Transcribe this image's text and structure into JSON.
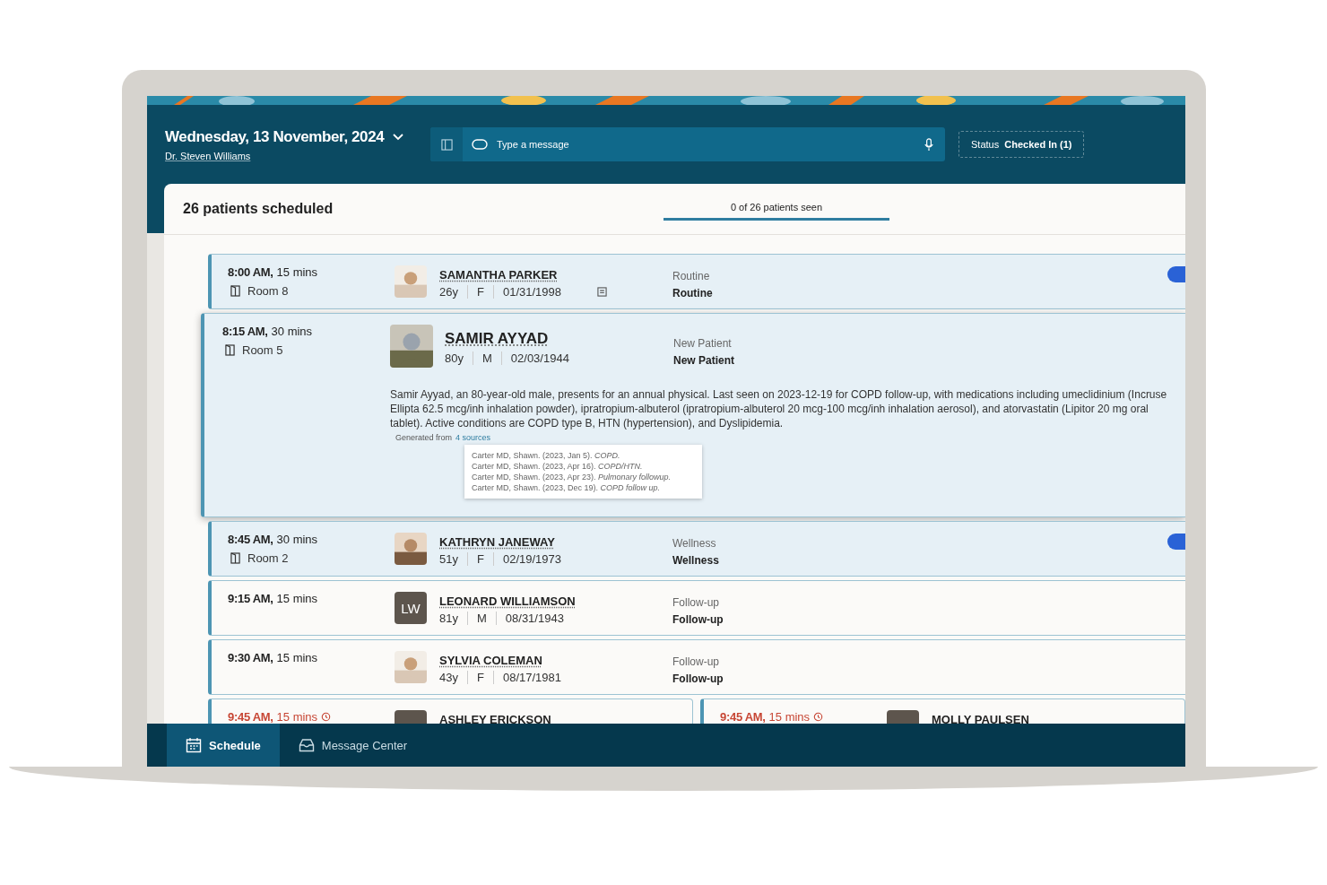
{
  "header": {
    "date": "Wednesday, 13 November, 2024",
    "doctor": "Dr. Steven Williams",
    "message_field": {
      "placeholder": "Type a message"
    },
    "status_button": {
      "label": "Status",
      "value": "Checked In (1)"
    }
  },
  "schedule": {
    "title": "26 patients scheduled",
    "progress": {
      "label": "0 of 26 patients seen",
      "level": 0
    },
    "slots": [
      {
        "appointments": [
          {
            "time": "8:00 AM,",
            "duration": "15 mins",
            "room": "Room 8",
            "name": "SAMANTHA PARKER",
            "age": "26y",
            "sex": "F",
            "dob": "01/31/1998",
            "has_note": true,
            "visit_type": "Routine",
            "reason": "Routine",
            "checked_in": true,
            "late": false,
            "expanded": false,
            "visibility_toggle": true
          }
        ]
      },
      {
        "appointments": [
          {
            "time": "8:15 AM,",
            "duration": "30 mins",
            "room": "Room 5",
            "name": "SAMIR AYYAD",
            "age": "80y",
            "sex": "M",
            "dob": "02/03/1944",
            "has_note": false,
            "visit_type": "New Patient",
            "reason": "New Patient",
            "checked_in": true,
            "late": false,
            "expanded": true,
            "visibility_toggle": false,
            "summary": "Samir Ayyad, an 80-year-old male, presents for an annual physical. Last seen on 2023-12-19 for COPD follow-up, with medications including umeclidinium (Incruse Ellipta 62.5 mcg/inh inhalation powder), ipratropium-albuterol (ipratropium-albuterol 20 mcg-100 mcg/inh inhalation aerosol), and atorvastatin (Lipitor 20 mg oral tablet). Active conditions are COPD type B, HTN (hypertension), and Dyslipidemia.",
            "sources_label": "Generated from",
            "sources_link": "4 sources",
            "sources": [
              "Carter MD, Shawn. (2023, Jan 5). *COPD.*",
              "Carter MD, Shawn. (2023, Apr 16). *COPD/HTN.*",
              "Carter MD, Shawn. (2023, Apr 23). *Pulmonary followup.*",
              "Carter MD, Shawn. (2023, Dec 19). *COPD follow up.*"
            ]
          }
        ]
      },
      {
        "appointments": [
          {
            "time": "8:45 AM,",
            "duration": "30 mins",
            "room": "Room 2",
            "name": "KATHRYN JANEWAY",
            "age": "51y",
            "sex": "F",
            "dob": "02/19/1973",
            "has_note": false,
            "visit_type": "Wellness",
            "reason": "Wellness",
            "checked_in": true,
            "late": false,
            "expanded": false,
            "visibility_toggle": true
          }
        ]
      },
      {
        "appointments": [
          {
            "time": "9:15 AM,",
            "duration": "15 mins",
            "name": "LEONARD WILLIAMSON",
            "age": "81y",
            "sex": "M",
            "dob": "08/31/1943",
            "has_note": false,
            "visit_type": "Follow-up",
            "reason": "Follow-up",
            "checked_in": false,
            "late": false,
            "expanded": false,
            "visibility_toggle": false,
            "avatar": {
              "kind": "initials",
              "initials": "LW"
            }
          }
        ]
      },
      {
        "appointments": [
          {
            "time": "9:30 AM,",
            "duration": "15 mins",
            "name": "SYLVIA COLEMAN",
            "age": "43y",
            "sex": "F",
            "dob": "08/17/1981",
            "has_note": false,
            "visit_type": "Follow-up",
            "reason": "Follow-up",
            "checked_in": false,
            "late": false,
            "expanded": false,
            "visibility_toggle": false
          }
        ]
      },
      {
        "appointments": [
          {
            "time": "9:45 AM,",
            "duration": "15 mins",
            "name": "ASHLEY ERICKSON",
            "checked_in": false,
            "late": true,
            "expanded": false,
            "visibility_toggle": false,
            "avatar": {
              "kind": "initials"
            }
          },
          {
            "time": "9:45 AM,",
            "duration": "15 mins",
            "name": "MOLLY PAULSEN",
            "checked_in": false,
            "late": true,
            "expanded": false,
            "visibility_toggle": false,
            "avatar": {
              "kind": "initials"
            }
          }
        ]
      }
    ]
  },
  "nav": [
    {
      "label": "Schedule",
      "selected": true
    },
    {
      "label": "Message Center",
      "selected": false
    }
  ]
}
